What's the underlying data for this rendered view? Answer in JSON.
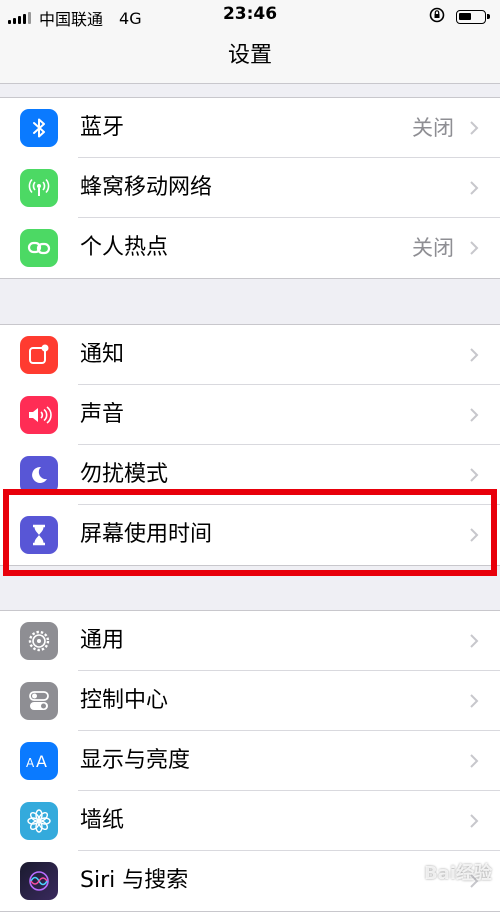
{
  "status_bar": {
    "carrier": "中国联通",
    "network": "4G",
    "time": "23:46"
  },
  "nav": {
    "title": "设置"
  },
  "groups": [
    {
      "rows": [
        {
          "label": "蓝牙",
          "value": "关闭",
          "icon": "bluetooth-icon",
          "color": "#0a7aff"
        },
        {
          "label": "蜂窝移动网络",
          "value": "",
          "icon": "antenna-icon",
          "color": "#4cd964"
        },
        {
          "label": "个人热点",
          "value": "关闭",
          "icon": "hotspot-icon",
          "color": "#4cd964"
        }
      ]
    },
    {
      "rows": [
        {
          "label": "通知",
          "icon": "notification-icon",
          "color": "#ff3b30"
        },
        {
          "label": "声音",
          "icon": "speaker-icon",
          "color": "#ff2d55"
        },
        {
          "label": "勿扰模式",
          "icon": "moon-icon",
          "color": "#5856d6"
        },
        {
          "label": "屏幕使用时间",
          "icon": "hourglass-icon",
          "color": "#5856d6"
        }
      ]
    },
    {
      "rows": [
        {
          "label": "通用",
          "icon": "gear-icon",
          "color": "#8e8e93"
        },
        {
          "label": "控制中心",
          "icon": "toggles-icon",
          "color": "#8e8e93"
        },
        {
          "label": "显示与亮度",
          "icon": "text-size-icon",
          "color": "#0a7aff"
        },
        {
          "label": "墙纸",
          "icon": "flower-icon",
          "color": "#34aadc"
        },
        {
          "label": "Siri 与搜索",
          "icon": "siri-icon",
          "color": "#222222"
        }
      ]
    }
  ],
  "watermark": "Bai经验"
}
